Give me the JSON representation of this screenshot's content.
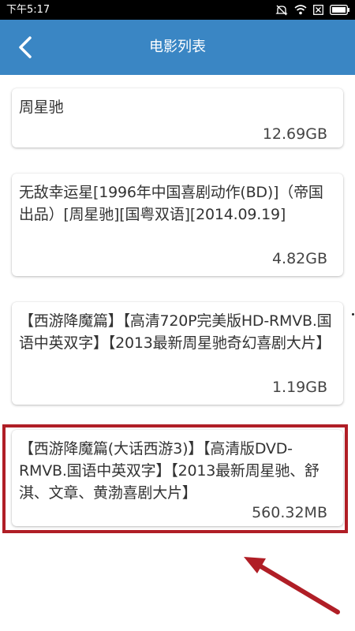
{
  "status_bar": {
    "time": "下午5:17"
  },
  "header": {
    "title": "电影列表",
    "back_icon": "chevron-left-icon"
  },
  "movies": [
    {
      "title": "周星驰",
      "size": "12.69GB"
    },
    {
      "title": "无敌幸运星[1996年中国喜剧动作(BD)]（帝国出品）[周星驰][国粤双语][2014.09.19]",
      "size": "4.82GB"
    },
    {
      "title": "【西游降魔篇】【高清720P完美版HD-RMVB.国语中英双字】【2013最新周星驰奇幻喜剧大片】",
      "size": "1.19GB"
    },
    {
      "title": "【西游降魔篇(大话西游3)】【高清版DVD-RMVB.国语中英双字】【2013最新周星驰、舒淇、文章、黄渤喜剧大片】",
      "size": "560.32MB"
    }
  ],
  "colors": {
    "app_bar": "#3a86c4",
    "highlight": "#b01e26"
  }
}
